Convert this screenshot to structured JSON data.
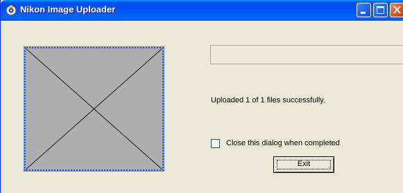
{
  "window": {
    "title": "Nikon Image Uploader"
  },
  "icons": {
    "app": "nikon-app-icon",
    "minimize": "minimize-icon",
    "maximize": "maximize-icon",
    "close": "close-icon",
    "preview_placeholder": "image-placeholder-icon"
  },
  "progress": {
    "fraction": 0
  },
  "status": {
    "message": "Uploaded 1 of 1 files successfully."
  },
  "options": {
    "close_when_completed": {
      "label": "Close this dialog when completed",
      "checked": false
    }
  },
  "buttons": {
    "exit_label": "Exit"
  },
  "colors": {
    "titlebar": "#0053ee",
    "window_bg": "#ece9d8",
    "preview_bg": "#aeaeae",
    "close_button": "#d9532b"
  }
}
